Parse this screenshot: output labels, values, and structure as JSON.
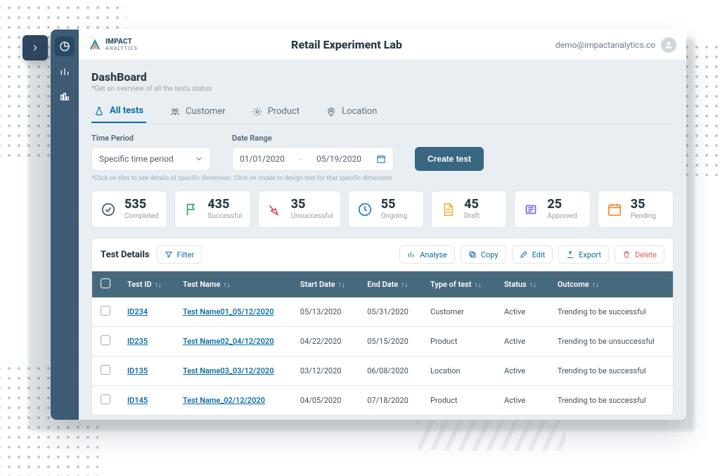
{
  "brand": {
    "top": "IMPACT",
    "bottom": "ANALYTICS"
  },
  "header": {
    "title": "Retail Experiment Lab",
    "email": "demo@impactanalytics.co"
  },
  "page": {
    "title": "DashBoard",
    "subtitle": "*Get an overview of all the tests status"
  },
  "tabs": [
    {
      "label": "All tests",
      "icon": "flask",
      "active": true
    },
    {
      "label": "Customer",
      "icon": "people",
      "active": false
    },
    {
      "label": "Product",
      "icon": "gear",
      "active": false
    },
    {
      "label": "Location",
      "icon": "pin",
      "active": false
    }
  ],
  "filters": {
    "timePeriod": {
      "label": "Time Period",
      "value": "Specific time period"
    },
    "dateRange": {
      "label": "Date Range",
      "from": "01/01/2020",
      "to": "05/19/2020",
      "sep": "-"
    },
    "createBtn": "Create test",
    "helper": "*Click on tiles to see details of specific dimension. Click on create to design test for that specific dimension"
  },
  "kpis": [
    {
      "value": "535",
      "label": "Completed",
      "icon": "check",
      "color": "#4f6272"
    },
    {
      "value": "435",
      "label": "Successful",
      "icon": "flag",
      "color": "#3bb273"
    },
    {
      "value": "35",
      "label": "Unsuccessful",
      "icon": "down",
      "color": "#e05b6b"
    },
    {
      "value": "55",
      "label": "Ongoing",
      "icon": "clock",
      "color": "#2b87c6"
    },
    {
      "value": "45",
      "label": "Draft",
      "icon": "doc",
      "color": "#e9b949"
    },
    {
      "value": "25",
      "label": "Approved",
      "icon": "stamp",
      "color": "#7a6ff0"
    },
    {
      "value": "35",
      "label": "Pending",
      "icon": "calendar",
      "color": "#f08f3b"
    }
  ],
  "details": {
    "title": "Test Details",
    "filter": "Filter",
    "actions": [
      {
        "label": "Analyse",
        "icon": "bar"
      },
      {
        "label": "Copy",
        "icon": "copy"
      },
      {
        "label": "Edit",
        "icon": "edit"
      },
      {
        "label": "Export",
        "icon": "export"
      },
      {
        "label": "Delete",
        "icon": "trash",
        "danger": true
      }
    ],
    "columns": [
      "Test ID",
      "Test Name",
      "Start Date",
      "End Date",
      "Type of test",
      "Status",
      "Outcome"
    ],
    "rows": [
      {
        "id": "ID234",
        "name": "Test Name01_05/12/2020",
        "start": "05/13/2020",
        "end": "05/31/2020",
        "type": "Customer",
        "status": "Active",
        "outcome": "Trending to be successful"
      },
      {
        "id": "ID235",
        "name": "Test Name02_04/12/2020",
        "start": "04/22/2020",
        "end": "05/15/2020",
        "type": "Product",
        "status": "Active",
        "outcome": "Trending to be unsuccessful"
      },
      {
        "id": "ID135",
        "name": "Test Name03_03/12/2020",
        "start": "03/12/2020",
        "end": "06/08/2020",
        "type": "Location",
        "status": "Active",
        "outcome": "Trending to be successful"
      },
      {
        "id": "ID145",
        "name": "Test Name_02/12/2020",
        "start": "04/05/2020",
        "end": "07/18/2020",
        "type": "Product",
        "status": "Active",
        "outcome": "Trending to be successful"
      }
    ]
  }
}
